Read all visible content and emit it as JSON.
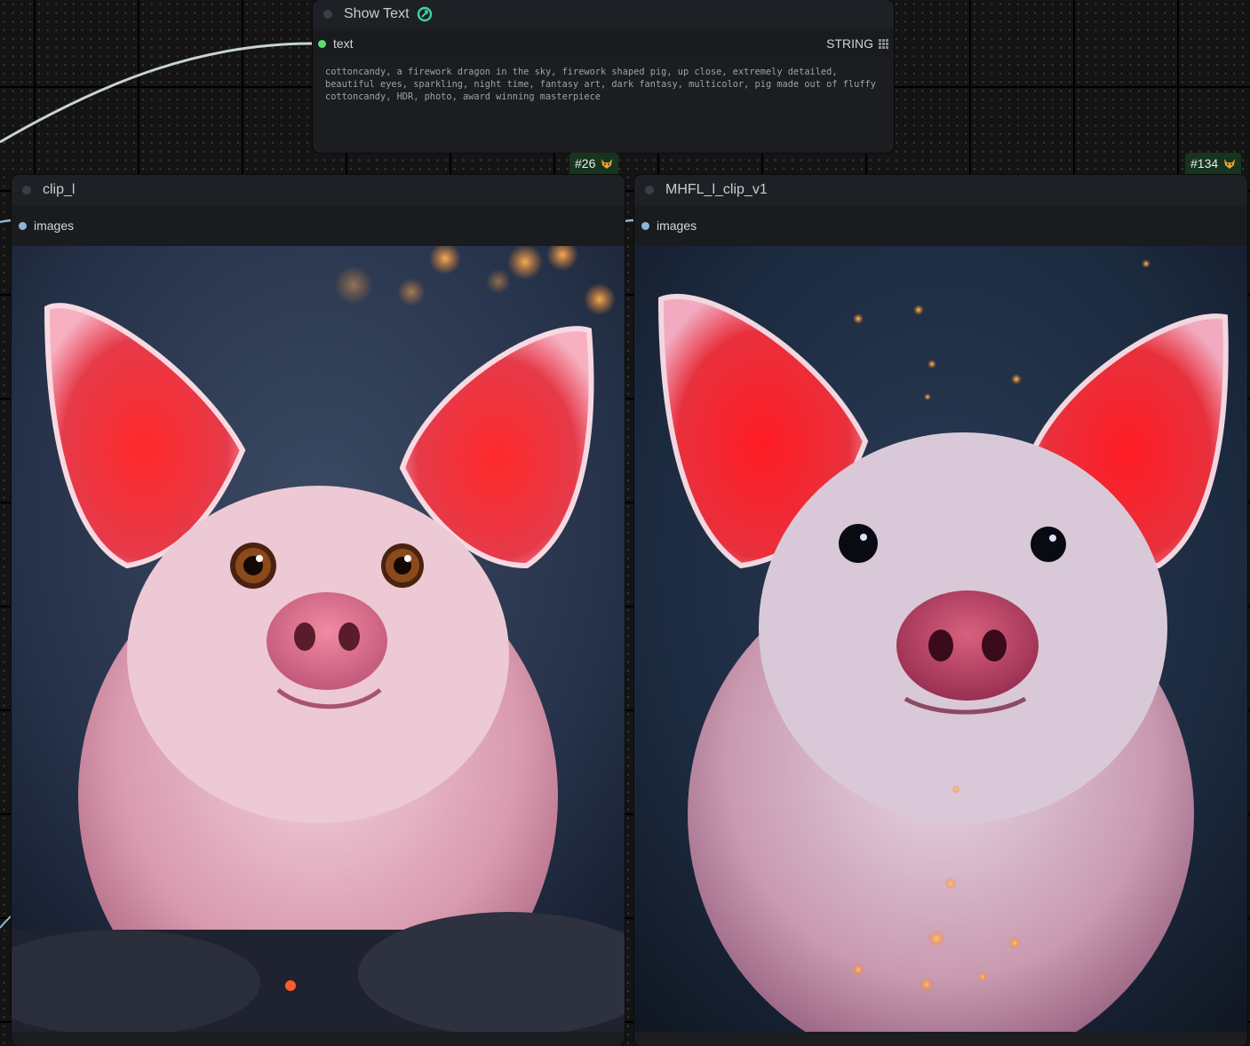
{
  "show_text_node": {
    "title": "Show Text",
    "input_label": "text",
    "type_label": "STRING",
    "text_value": "cottoncandy, a firework dragon in the sky, firework shaped pig, up close, extremely detailed, beautiful eyes, sparkling, night time, fantasy art, dark fantasy, multicolor, pig made out of fluffy cottoncandy, HDR, photo, award winning masterpiece"
  },
  "left_node": {
    "id_tag": "#26",
    "title": "clip_l",
    "input_label": "images"
  },
  "right_node": {
    "id_tag": "#134",
    "title": "MHFL_l_clip_v1",
    "input_label": "images"
  },
  "colors": {
    "canvas_bg": "#141414",
    "node_bg": "#1b1d20",
    "tag_bg": "#17351e",
    "socket_string": "#5fdc6e",
    "socket_image": "#8ab6d8",
    "wire": "#c7d3cf"
  },
  "icons": {
    "show_text_badge": "link-badge-icon",
    "tag_badge": "fox-icon"
  }
}
